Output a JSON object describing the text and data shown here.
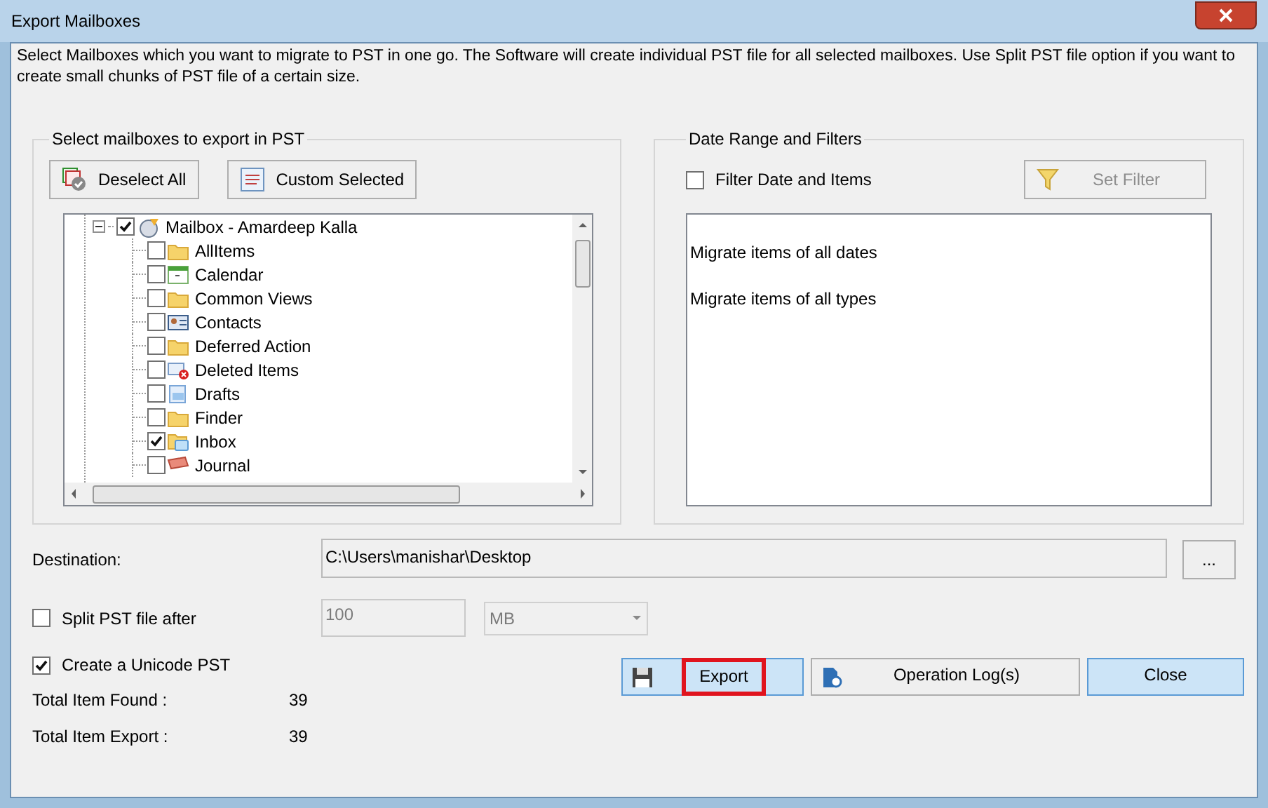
{
  "window": {
    "title": "Export Mailboxes"
  },
  "description": "Select Mailboxes which you want to migrate to PST in one go. The Software will create individual PST file for all selected mailboxes. Use Split PST file option if you want to create small chunks of PST file of a certain size.",
  "mailbox_group": {
    "title": "Select mailboxes to export in PST",
    "buttons": [
      "Deselect All",
      "Custom Selected"
    ],
    "tree": {
      "label": "Mailbox - Amardeep Kalla",
      "checked": true,
      "expanded": true,
      "children": [
        {
          "label": "AllItems",
          "kind": "folder",
          "checked": false
        },
        {
          "label": "Calendar",
          "kind": "calendar",
          "checked": false
        },
        {
          "label": "Common Views",
          "kind": "folder",
          "checked": false
        },
        {
          "label": "Contacts",
          "kind": "contacts",
          "checked": false
        },
        {
          "label": "Deferred Action",
          "kind": "folder",
          "checked": false
        },
        {
          "label": "Deleted Items",
          "kind": "deleted",
          "checked": false
        },
        {
          "label": "Drafts",
          "kind": "drafts",
          "checked": false
        },
        {
          "label": "Finder",
          "kind": "folder",
          "checked": false
        },
        {
          "label": "Inbox",
          "kind": "inbox",
          "checked": true
        },
        {
          "label": "Journal",
          "kind": "journal",
          "checked": false
        }
      ]
    }
  },
  "filter_group": {
    "title": "Date Range and Filters",
    "filter_checkbox": {
      "label": "Filter Date and Items",
      "checked": false
    },
    "set_filter_button": {
      "label": "Set Filter",
      "disabled": true
    },
    "summary": [
      "Migrate items of all dates",
      "Migrate items of all types"
    ]
  },
  "destination": {
    "label": "Destination:",
    "value": "C:\\Users\\manishar\\Desktop",
    "browse_button": "..."
  },
  "split": {
    "label": "Split PST file after",
    "checked": false,
    "size": "100",
    "unit": "MB"
  },
  "unicode": {
    "label": "Create a Unicode PST",
    "checked": true
  },
  "totals": [
    {
      "label": "Total Item Found :",
      "value": "39"
    },
    {
      "label": "Total Item Export :",
      "value": "39"
    }
  ],
  "actions": [
    {
      "label": "Export",
      "kind": "export",
      "highlighted": true
    },
    {
      "label": "Operation Log(s)",
      "kind": "log",
      "highlighted": false
    },
    {
      "label": "Close",
      "kind": "close",
      "highlighted": false
    }
  ]
}
